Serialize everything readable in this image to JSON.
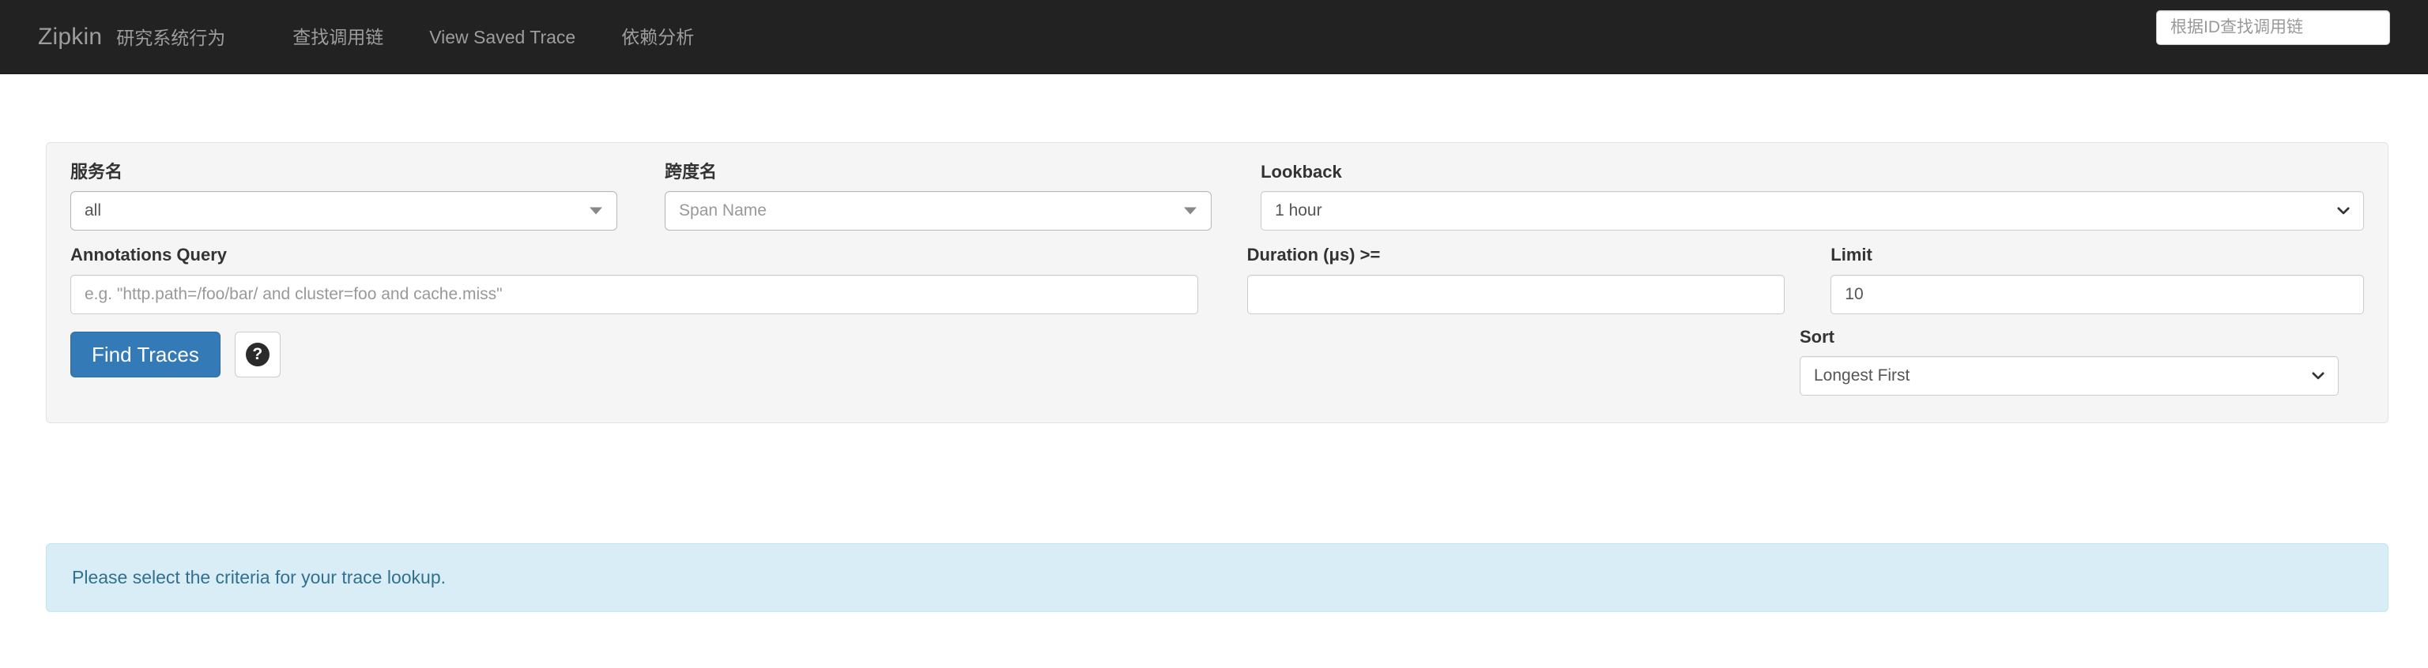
{
  "navbar": {
    "brand": "Zipkin",
    "brand_subtitle": "研究系统行为",
    "links": [
      {
        "label": "查找调用链"
      },
      {
        "label": "View Saved Trace"
      },
      {
        "label": "依赖分析"
      }
    ],
    "trace_id_search": {
      "value": "",
      "placeholder": "根据ID查找调用链"
    }
  },
  "search_panel": {
    "service_name": {
      "label": "服务名",
      "value": "all",
      "caret": "caret-down-icon"
    },
    "span_name": {
      "label": "跨度名",
      "value": "",
      "placeholder": "Span Name",
      "caret": "caret-down-icon"
    },
    "lookback": {
      "label": "Lookback",
      "value": "1 hour",
      "caret": "chevron-down-icon"
    },
    "annotations_query": {
      "label": "Annotations Query",
      "value": "",
      "placeholder": "e.g. \"http.path=/foo/bar/ and cluster=foo and cache.miss\""
    },
    "duration": {
      "label": "Duration (μs) >=",
      "value": "",
      "placeholder": ""
    },
    "limit": {
      "label": "Limit",
      "value": "10",
      "placeholder": ""
    },
    "sort": {
      "label": "Sort",
      "value": "Longest First",
      "caret": "chevron-down-icon"
    },
    "find_traces_button": "Find Traces",
    "help_button": "?"
  },
  "alert": {
    "message": "Please select the criteria for your trace lookup."
  },
  "colors": {
    "navbar_bg": "#222222",
    "navbar_text": "#9d9d9d",
    "panel_bg": "#f5f5f5",
    "panel_border": "#e3e3e3",
    "primary_button": "#337ab7",
    "alert_bg": "#d9edf7",
    "alert_border": "#bce8f1",
    "alert_text": "#31708f"
  }
}
